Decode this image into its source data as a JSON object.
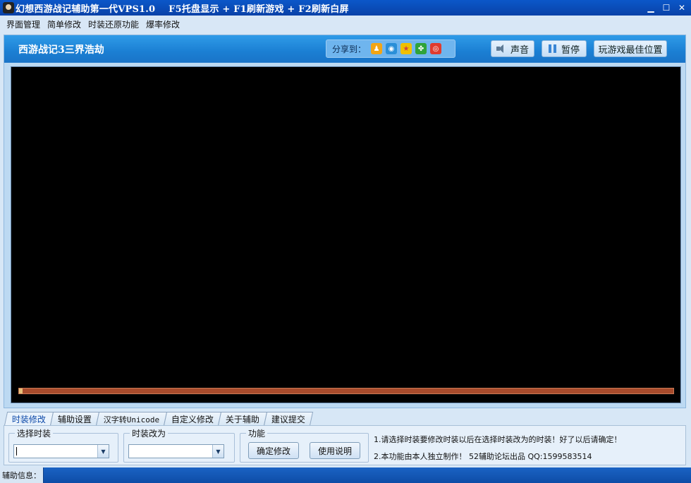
{
  "window": {
    "title": "幻想西游战记辅助第一代VPS1.0    F5托盘显示 + F1刷新游戏 + F2刷新白屏",
    "controls": {
      "minimize": "▁",
      "maximize": "☐",
      "close": "✕"
    }
  },
  "menu": {
    "items": [
      "界面管理",
      "简单修改",
      "时装还原功能",
      "爆率修改"
    ]
  },
  "game": {
    "title": "西游战记3三界浩劫",
    "share_label": "分享到：",
    "share_icons": [
      {
        "name": "qq-icon",
        "color": "#f2a515"
      },
      {
        "name": "qzone-icon",
        "color": "#2a8fd8"
      },
      {
        "name": "star-icon",
        "color": "#f0c000"
      },
      {
        "name": "clover-icon",
        "color": "#2fa33a"
      },
      {
        "name": "weibo-icon",
        "color": "#e03b2e"
      }
    ],
    "sound_label": "声音",
    "pause_label": "暂停",
    "best_position_label": "玩游戏最佳位置",
    "progress": 0.005
  },
  "tabs": [
    "时装修改",
    "辅助设置",
    "汉字转Unicode",
    "自定义修改",
    "关于辅助",
    "建议提交"
  ],
  "active_tab": 0,
  "panel": {
    "select_costume_label": "选择时装",
    "select_costume_value": "",
    "change_to_label": "时装改为",
    "change_to_value": "",
    "function_label": "功能",
    "confirm_label": "确定修改",
    "help_label": "使用说明",
    "info_line_1": "1.请选择时装要修改时装以后在选择时装改为的时装！好了以后请确定！",
    "info_line_2": "2.本功能由本人独立制作！  52辅助论坛出品 QQ:1599583514"
  },
  "status": {
    "label": "辅助信息："
  }
}
